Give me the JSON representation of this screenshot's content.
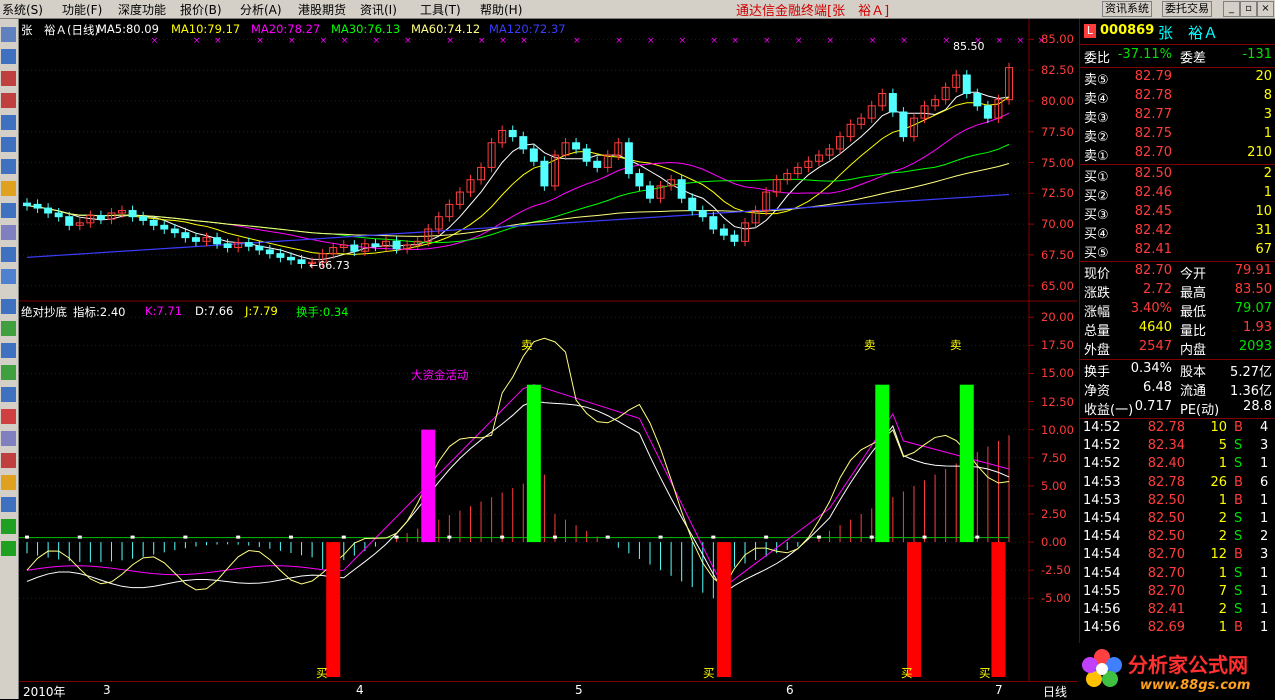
{
  "menu": {
    "items": [
      "系统(S)",
      "功能(F)",
      "深度功能",
      "报价(B)",
      "分析(A)",
      "港股期货",
      "资讯(I)",
      "工具(T)",
      "帮助(H)"
    ],
    "app_title": "通达信金融终端[张　裕Ａ]",
    "btn_info": "资讯系统",
    "btn_trade": "委托交易"
  },
  "main_header": {
    "stock": "张　裕Ａ(日线)",
    "ma5": "MA5:80.09",
    "ma10": "MA10:79.17",
    "ma20": "MA20:78.27",
    "ma30": "MA30:76.13",
    "ma60": "MA60:74.12",
    "ma120": "MA120:72.37"
  },
  "ind_header": {
    "name": "绝对抄底",
    "idx": "指标:2.40",
    "k": "K:7.71",
    "d": "D:7.66",
    "j": "J:7.79",
    "hs": "换手:0.34"
  },
  "price_axis": [
    "85.00",
    "82.50",
    "80.00",
    "77.50",
    "75.00",
    "72.50",
    "70.00",
    "67.50",
    "65.00"
  ],
  "ind_axis": [
    "20.00",
    "17.50",
    "15.00",
    "12.50",
    "10.00",
    "7.50",
    "5.00",
    "2.50",
    "0.00",
    "-2.50",
    "-5.00"
  ],
  "annotations": {
    "high": "85.50",
    "low": "←66.73",
    "big_money": "大资金活动",
    "sell": "卖",
    "buy": "买"
  },
  "time_axis": [
    "2010年",
    "3",
    "4",
    "5",
    "6",
    "7"
  ],
  "period": "日线",
  "quote": {
    "code": "000869",
    "name": "张　裕Ａ",
    "weibi_label": "委比",
    "weibi": "-37.11%",
    "weicha_label": "委差",
    "weicha": "-131",
    "asks": [
      {
        "label": "卖⑤",
        "price": "82.79",
        "vol": "20"
      },
      {
        "label": "卖④",
        "price": "82.78",
        "vol": "8"
      },
      {
        "label": "卖③",
        "price": "82.77",
        "vol": "3"
      },
      {
        "label": "卖②",
        "price": "82.75",
        "vol": "1"
      },
      {
        "label": "卖①",
        "price": "82.70",
        "vol": "210"
      }
    ],
    "bids": [
      {
        "label": "买①",
        "price": "82.50",
        "vol": "2"
      },
      {
        "label": "买②",
        "price": "82.46",
        "vol": "1"
      },
      {
        "label": "买③",
        "price": "82.45",
        "vol": "10"
      },
      {
        "label": "买④",
        "price": "82.42",
        "vol": "31"
      },
      {
        "label": "买⑤",
        "price": "82.41",
        "vol": "67"
      }
    ],
    "stats": [
      {
        "l1": "现价",
        "v1": "82.70",
        "c1": "red",
        "l2": "今开",
        "v2": "79.91",
        "c2": "red"
      },
      {
        "l1": "涨跌",
        "v1": "2.72",
        "c1": "red",
        "l2": "最高",
        "v2": "83.50",
        "c2": "red"
      },
      {
        "l1": "涨幅",
        "v1": "3.40%",
        "c1": "red",
        "l2": "最低",
        "v2": "79.07",
        "c2": "green"
      },
      {
        "l1": "总量",
        "v1": "4640",
        "c1": "yel",
        "l2": "量比",
        "v2": "1.93",
        "c2": "red"
      },
      {
        "l1": "外盘",
        "v1": "2547",
        "c1": "red",
        "l2": "内盘",
        "v2": "2093",
        "c2": "green"
      }
    ],
    "stats2": [
      {
        "l1": "换手",
        "v1": "0.34%",
        "l2": "股本",
        "v2": "5.27亿"
      },
      {
        "l1": "净资",
        "v1": "6.48",
        "l2": "流通",
        "v2": "1.36亿"
      },
      {
        "l1": "收益(一)",
        "v1": "0.717",
        "l2": "PE(动)",
        "v2": "28.8"
      }
    ],
    "ticks": [
      {
        "t": "14:52",
        "p": "82.78",
        "pc": "red",
        "q": "10",
        "bs": "B",
        "n": "4"
      },
      {
        "t": "14:52",
        "p": "82.34",
        "pc": "red",
        "q": "5",
        "bs": "S",
        "n": "3"
      },
      {
        "t": "14:52",
        "p": "82.40",
        "pc": "red",
        "q": "1",
        "bs": "S",
        "n": "1"
      },
      {
        "t": "14:53",
        "p": "82.78",
        "pc": "red",
        "q": "26",
        "bs": "B",
        "n": "6"
      },
      {
        "t": "14:53",
        "p": "82.50",
        "pc": "red",
        "q": "1",
        "bs": "B",
        "n": "1"
      },
      {
        "t": "14:54",
        "p": "82.50",
        "pc": "red",
        "q": "2",
        "bs": "S",
        "n": "1"
      },
      {
        "t": "14:54",
        "p": "82.50",
        "pc": "red",
        "q": "2",
        "bs": "S",
        "n": "2"
      },
      {
        "t": "14:54",
        "p": "82.70",
        "pc": "red",
        "q": "12",
        "bs": "B",
        "n": "3"
      },
      {
        "t": "14:54",
        "p": "82.70",
        "pc": "red",
        "q": "1",
        "bs": "S",
        "n": "1"
      },
      {
        "t": "14:55",
        "p": "82.70",
        "pc": "red",
        "q": "7",
        "bs": "S",
        "n": "1"
      },
      {
        "t": "14:56",
        "p": "82.41",
        "pc": "red",
        "q": "2",
        "bs": "S",
        "n": "1"
      },
      {
        "t": "14:56",
        "p": "82.69",
        "pc": "red",
        "q": "1",
        "bs": "B",
        "n": "1"
      }
    ]
  },
  "watermark": {
    "title": "分析家公式网",
    "url": "www.88gs.com"
  },
  "colors": {
    "up": "#ff3c3c",
    "down": "#54ffff",
    "ma5": "#ffffff",
    "ma10": "#ffff00",
    "ma20": "#ff00ff",
    "ma30": "#00ff00",
    "ma60": "#ffff80",
    "ma120": "#3c3cff",
    "sell_bar": "#00ff00",
    "buy_bar": "#ff0000",
    "big_money": "#ff00ff"
  },
  "chart_data": [
    {
      "type": "candlestick",
      "title": "张　裕Ａ(日线)",
      "ylim": [
        64,
        86
      ],
      "annotations": {
        "high": 85.5,
        "low": 66.73
      },
      "closes": [
        71.5,
        71.3,
        70.9,
        70.6,
        69.9,
        70.1,
        70.7,
        70.4,
        70.9,
        71.1,
        70.6,
        70.3,
        69.9,
        69.6,
        69.3,
        68.9,
        68.6,
        68.9,
        68.4,
        68.1,
        68.5,
        68.2,
        67.9,
        67.6,
        67.3,
        67.1,
        66.8,
        66.9,
        67.6,
        68.1,
        68.3,
        67.8,
        68.4,
        68.2,
        68.6,
        68.0,
        68.3,
        68.6,
        69.6,
        70.6,
        71.6,
        72.6,
        73.6,
        74.6,
        76.6,
        77.6,
        77.1,
        76.1,
        75.1,
        73.1,
        75.6,
        76.6,
        76.1,
        75.1,
        74.6,
        75.6,
        76.6,
        74.1,
        73.1,
        72.1,
        73.1,
        73.6,
        72.1,
        71.1,
        70.6,
        69.6,
        69.1,
        68.6,
        70.1,
        71.1,
        72.6,
        73.6,
        74.1,
        74.6,
        75.1,
        75.6,
        76.1,
        77.1,
        78.1,
        78.6,
        79.6,
        80.6,
        79.1,
        77.1,
        78.6,
        79.6,
        80.1,
        81.1,
        82.1,
        80.6,
        79.6,
        78.6,
        80.1,
        82.7
      ],
      "opens": [
        71.7,
        71.6,
        71.3,
        70.9,
        70.6,
        69.9,
        70.1,
        70.7,
        70.4,
        70.9,
        71.1,
        70.6,
        70.3,
        69.9,
        69.6,
        69.3,
        68.9,
        68.6,
        68.9,
        68.4,
        68.1,
        68.5,
        68.2,
        67.9,
        67.6,
        67.3,
        67.1,
        66.8,
        66.9,
        67.6,
        68.1,
        68.3,
        67.8,
        68.4,
        68.2,
        68.6,
        68.0,
        68.3,
        68.6,
        69.6,
        70.6,
        71.6,
        72.6,
        73.6,
        74.6,
        76.6,
        77.6,
        77.1,
        76.1,
        75.1,
        73.1,
        75.6,
        76.6,
        76.1,
        75.1,
        74.6,
        75.6,
        76.6,
        74.1,
        73.1,
        72.1,
        73.1,
        73.6,
        72.1,
        71.1,
        70.6,
        69.6,
        69.1,
        68.6,
        70.1,
        71.1,
        72.6,
        73.6,
        74.1,
        74.6,
        75.1,
        75.6,
        76.1,
        77.1,
        78.1,
        78.6,
        79.6,
        80.6,
        79.1,
        77.1,
        78.6,
        79.6,
        80.1,
        81.1,
        82.1,
        80.6,
        79.6,
        78.6,
        80.1
      ]
    },
    {
      "type": "bar",
      "title": "绝对抄底",
      "ylim": [
        -12,
        21
      ],
      "signals": [
        {
          "kind": "big_money",
          "index": 38,
          "value": 10.0
        },
        {
          "kind": "sell",
          "index": 48,
          "value": 14.0
        },
        {
          "kind": "sell",
          "index": 81,
          "value": 14.0
        },
        {
          "kind": "sell",
          "index": 89,
          "value": 14.0
        },
        {
          "kind": "buy",
          "index": 29,
          "value": -12.0
        },
        {
          "kind": "buy",
          "index": 66,
          "value": -12.0
        },
        {
          "kind": "buy",
          "index": 84,
          "value": -12.0
        },
        {
          "kind": "buy",
          "index": 92,
          "value": -12.0
        }
      ]
    }
  ]
}
